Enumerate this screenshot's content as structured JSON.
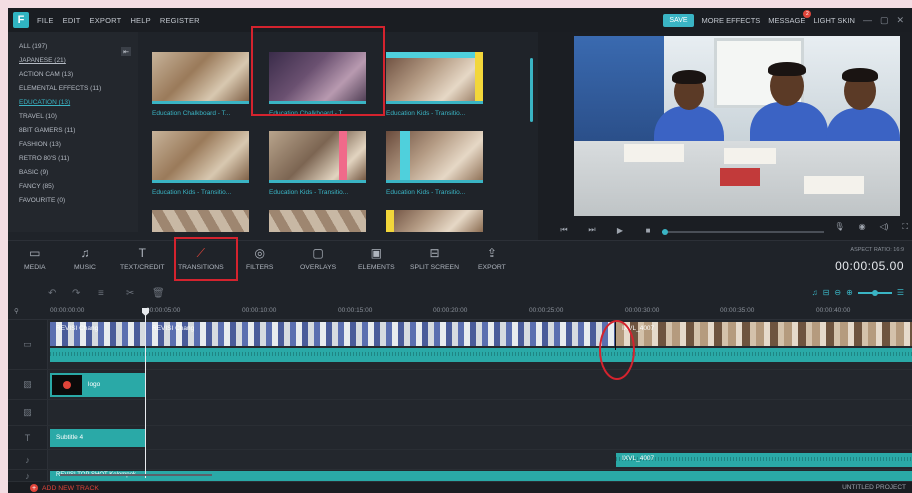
{
  "app": {
    "logo_letter": "F",
    "menu": [
      "FILE",
      "EDIT",
      "EXPORT",
      "HELP",
      "REGISTER"
    ],
    "save_label": "SAVE",
    "more_effects": "MORE EFFECTS",
    "message": "MESSAGE",
    "message_badge": "2",
    "light_skin": "LIGHT SKIN",
    "accent_color": "#3ab4c4"
  },
  "categories": [
    {
      "label": "ALL (197)",
      "active": false,
      "underline": false
    },
    {
      "label": "JAPANESE (21)",
      "active": false,
      "underline": true
    },
    {
      "label": "ACTION CAM (13)",
      "active": false,
      "underline": false
    },
    {
      "label": "ELEMENTAL EFFECTS (11)",
      "active": false,
      "underline": false
    },
    {
      "label": "EDUCATION (13)",
      "active": true,
      "underline": true
    },
    {
      "label": "TRAVEL (10)",
      "active": false,
      "underline": false
    },
    {
      "label": "8BIT GAMERS (11)",
      "active": false,
      "underline": false
    },
    {
      "label": "FASHION (13)",
      "active": false,
      "underline": false
    },
    {
      "label": "RETRO 80'S (11)",
      "active": false,
      "underline": false
    },
    {
      "label": "BASIC (9)",
      "active": false,
      "underline": false
    },
    {
      "label": "FANCY (85)",
      "active": false,
      "underline": false
    },
    {
      "label": "FAVOURITE (0)",
      "active": false,
      "underline": false
    }
  ],
  "thumbnails": [
    {
      "label": "Education Chalkboard - T..."
    },
    {
      "label": "Education Chalkboard - T..."
    },
    {
      "label": "Education Kids - Transitio..."
    },
    {
      "label": "Education Kids - Transitio..."
    },
    {
      "label": "Education Kids - Transitio..."
    },
    {
      "label": "Education Kids - Transitio..."
    },
    {
      "label": ""
    },
    {
      "label": ""
    },
    {
      "label": ""
    }
  ],
  "toolbar": [
    {
      "label": "MEDIA",
      "icon": "folder-icon"
    },
    {
      "label": "MUSIC",
      "icon": "music-note-icon"
    },
    {
      "label": "TEXT/CREDIT",
      "icon": "text-icon"
    },
    {
      "label": "TRANSITIONS",
      "icon": "transitions-icon"
    },
    {
      "label": "FILTERS",
      "icon": "filters-icon"
    },
    {
      "label": "OVERLAYS",
      "icon": "overlays-icon"
    },
    {
      "label": "ELEMENTS",
      "icon": "elements-icon"
    },
    {
      "label": "SPLIT SCREEN",
      "icon": "split-screen-icon"
    },
    {
      "label": "EXPORT",
      "icon": "export-icon"
    }
  ],
  "preview": {
    "aspect_ratio": "ASPECT RATIO: 16:9",
    "timecode": "00:00:05.00",
    "progress_fraction": 0.02
  },
  "ruler": [
    "00:00:00:00",
    "00:00:05:00",
    "00:00:10:00",
    "00:00:15:00",
    "00:00:20:00",
    "00:00:25:00",
    "00:00:30:00",
    "00:00:35:00",
    "00:00:40:00"
  ],
  "clips": {
    "video1": "REVISI Chang",
    "video2": "REVISI Chang",
    "video3": "IXVL_4007",
    "image": "logo",
    "text": "Subtitle 4",
    "audio": "IXVL_4007",
    "audio2": "REVISI TOP SHOT Kelompok"
  },
  "footer": {
    "add_track": "ADD NEW TRACK",
    "project": "UNTITLED PROJECT"
  }
}
